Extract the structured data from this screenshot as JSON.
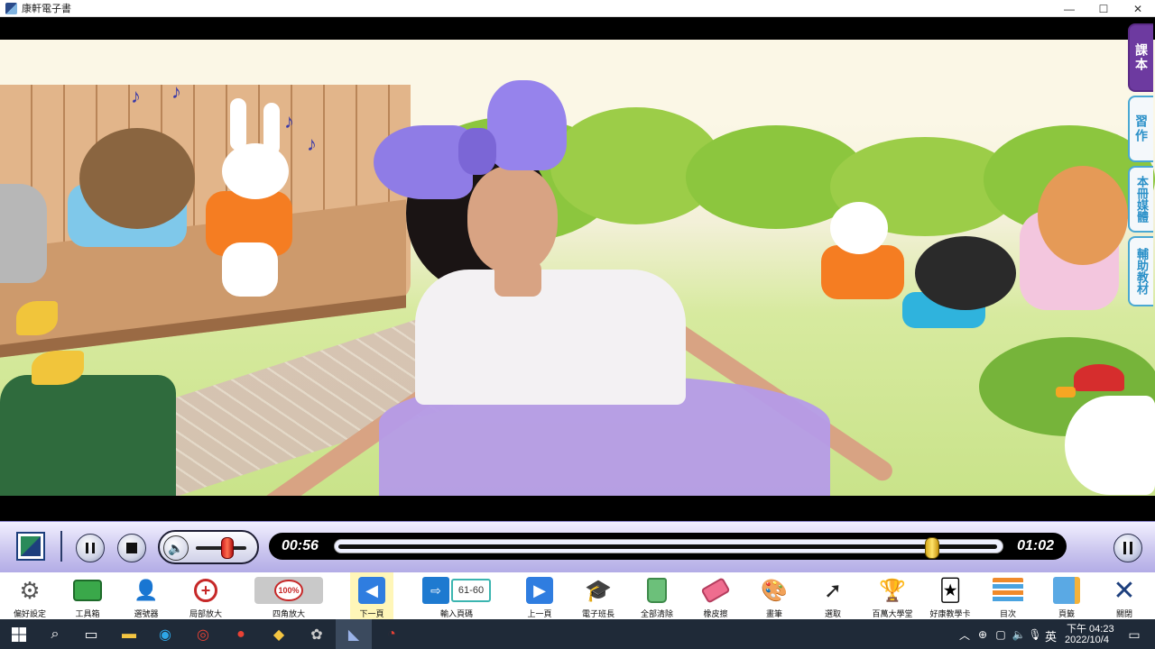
{
  "window": {
    "title": "康軒電子書",
    "controls": [
      "—",
      "☐",
      "✕"
    ]
  },
  "side_tabs": [
    {
      "label": "課本",
      "active": true
    },
    {
      "label": "習作",
      "active": false
    },
    {
      "label": "本冊媒體",
      "active": false
    },
    {
      "label": "輔助教材",
      "active": false
    }
  ],
  "player": {
    "current_time": "00:56",
    "total_time": "01:02",
    "progress": 0.9032,
    "volume": 0.62
  },
  "toolbar": [
    {
      "label": "偏好設定",
      "icon": "gear-icon"
    },
    {
      "label": "工具箱",
      "icon": "toolbox-icon"
    },
    {
      "label": "選號器",
      "icon": "number-picker-icon"
    },
    {
      "label": "局部放大",
      "icon": "zoom-icon"
    },
    {
      "label": "四角放大",
      "icon": "corner-zoom-icon",
      "badge": "100%"
    },
    {
      "label": "下一頁",
      "icon": "prev-arrow-icon"
    },
    {
      "label": "輸入頁碼",
      "icon": "page-input-icon",
      "page_value": "61-60"
    },
    {
      "label": "上一頁",
      "icon": "next-arrow-icon"
    },
    {
      "label": "電子班長",
      "icon": "grad-cap-icon"
    },
    {
      "label": "全部清除",
      "icon": "trash-icon"
    },
    {
      "label": "橡皮擦",
      "icon": "eraser-icon"
    },
    {
      "label": "畫筆",
      "icon": "palette-icon"
    },
    {
      "label": "選取",
      "icon": "cursor-icon"
    },
    {
      "label": "百萬大學堂",
      "icon": "trophy-icon"
    },
    {
      "label": "好康教學卡",
      "icon": "cards-icon"
    },
    {
      "label": "目次",
      "icon": "contents-icon"
    },
    {
      "label": "頁籤",
      "icon": "bookmark-icon"
    },
    {
      "label": "關閉",
      "icon": "close-icon"
    }
  ],
  "taskbar": {
    "ime": "英",
    "time": "下午 04:23",
    "date": "2022/10/4"
  },
  "colors": {
    "side_tab_active": "#6d3aa0",
    "side_tab": "#49a8d3",
    "media_bar": "#c9c4ee",
    "progress_knob": "#ffe36a",
    "taskbar": "#1f2a38"
  }
}
